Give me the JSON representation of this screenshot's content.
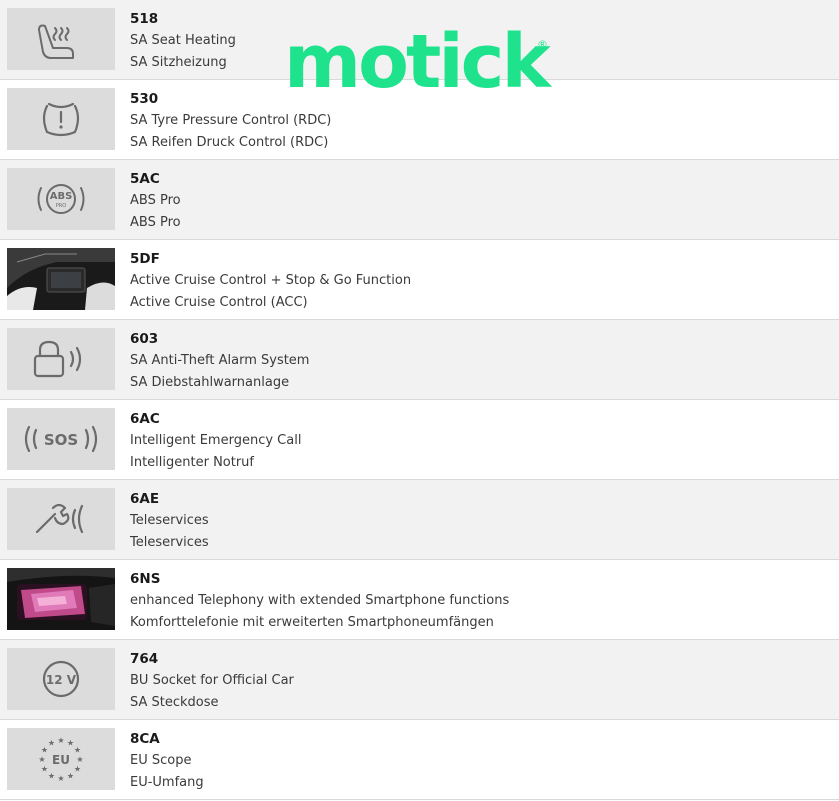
{
  "brand": {
    "watermark_text": "motick",
    "registered_mark": "®",
    "color": "#1ee38c"
  },
  "options": [
    {
      "code": "518",
      "line1": "SA Seat Heating",
      "line2": "SA Sitzheizung",
      "icon": "seat-heating-icon"
    },
    {
      "code": "530",
      "line1": "SA Tyre Pressure Control (RDC)",
      "line2": "SA Reifen Druck Control (RDC)",
      "icon": "tyre-pressure-icon"
    },
    {
      "code": "5AC",
      "line1": "ABS Pro",
      "line2": "ABS Pro",
      "icon": "abs-pro-icon",
      "icon_text": "ABS",
      "icon_subtext": "PRO"
    },
    {
      "code": "5DF",
      "line1": "Active Cruise Control + Stop & Go Function",
      "line2": "Active Cruise Control (ACC)",
      "icon": "cruise-control-photo"
    },
    {
      "code": "603",
      "line1": "SA Anti-Theft Alarm System",
      "line2": "SA Diebstahlwarnanlage",
      "icon": "lock-alarm-icon"
    },
    {
      "code": "6AC",
      "line1": "Intelligent Emergency Call",
      "line2": "Intelligenter Notruf",
      "icon": "sos-icon",
      "icon_text": "SOS"
    },
    {
      "code": "6AE",
      "line1": "Teleservices",
      "line2": "Teleservices",
      "icon": "wrench-signal-icon"
    },
    {
      "code": "6NS",
      "line1": "enhanced Telephony with extended Smartphone functions",
      "line2": "Komforttelefonie mit erweiterten Smartphoneumfängen",
      "icon": "smartphone-compartment-photo"
    },
    {
      "code": "764",
      "line1": "BU Socket for Official Car",
      "line2": "SA Steckdose",
      "icon": "socket-12v-icon",
      "icon_text": "12 V"
    },
    {
      "code": "8CA",
      "line1": "EU Scope",
      "line2": "EU-Umfang",
      "icon": "eu-stars-icon",
      "icon_text": "EU"
    }
  ]
}
